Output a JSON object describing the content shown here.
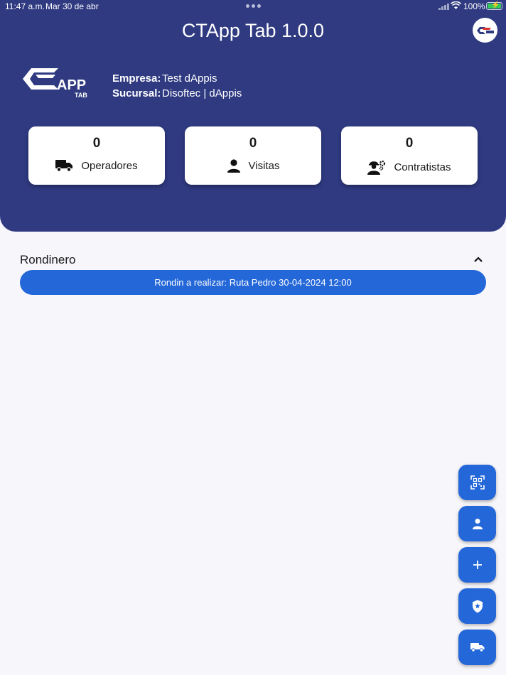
{
  "status_bar": {
    "time": "11:47 a.m.",
    "date": "Mar 30 de abr",
    "battery": "100%"
  },
  "app": {
    "title": "CTApp Tab 1.0.0"
  },
  "company": {
    "empresa_label": "Empresa:",
    "empresa_value": "Test dAppis",
    "sucursal_label": "Sucursal:",
    "sucursal_value": "Disoftec | dAppis"
  },
  "stats": [
    {
      "count": "0",
      "label": "Operadores",
      "icon": "truck-icon"
    },
    {
      "count": "0",
      "label": "Visitas",
      "icon": "person-icon"
    },
    {
      "count": "0",
      "label": "Contratistas",
      "icon": "worker-gear-icon"
    }
  ],
  "rondinero": {
    "title": "Rondinero",
    "route_text": "Rondin a realizar: Ruta Pedro 30-04-2024 12:00"
  },
  "fab_actions": [
    {
      "icon": "qr-scan-icon"
    },
    {
      "icon": "person-icon"
    },
    {
      "icon": "plus-icon"
    },
    {
      "icon": "shield-star-icon"
    },
    {
      "icon": "truck-icon"
    }
  ],
  "colors": {
    "header": "#2f3a81",
    "primary": "#2467d8",
    "background": "#f7f6fb",
    "card": "#ffffff"
  }
}
